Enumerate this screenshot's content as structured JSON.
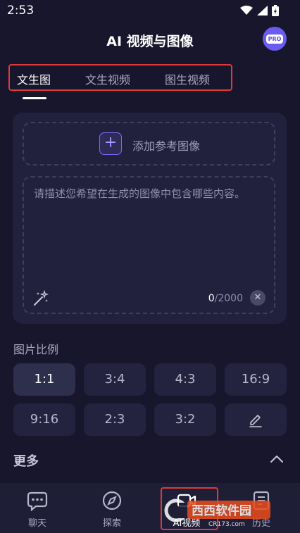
{
  "status": {
    "time": "2:53",
    "icons": [
      "wifi-icon",
      "signal-icon",
      "battery-icon"
    ]
  },
  "header": {
    "title": "AI 视频与图像",
    "pro_badge": "PRO"
  },
  "tabs": [
    {
      "label": "文生图",
      "active": true
    },
    {
      "label": "文生视频",
      "active": false
    },
    {
      "label": "图生视频",
      "active": false
    }
  ],
  "reference": {
    "label": "添加参考图像"
  },
  "prompt": {
    "placeholder": "请描述您希望在生成的图像中包含哪些内容。",
    "count_current": "0",
    "count_max": "/2000"
  },
  "ratio": {
    "label": "图片比例",
    "options": [
      "1:1",
      "3:4",
      "4:3",
      "16:9",
      "9:16",
      "2:3",
      "3:2"
    ],
    "selected": "1:1",
    "custom_icon": "edit-icon"
  },
  "more": {
    "label": "更多"
  },
  "bottom_nav": [
    {
      "label": "聊天",
      "icon": "chat-icon",
      "active": false
    },
    {
      "label": "探索",
      "icon": "compass-icon",
      "active": false
    },
    {
      "label": "AI视频",
      "icon": "video-icon",
      "active": true
    },
    {
      "label": "历史",
      "icon": "history-icon",
      "active": false
    }
  ],
  "watermark": {
    "text": "西西软件园",
    "url_text": "CR173.com"
  },
  "colors": {
    "background": "#17162c",
    "card": "#22213d",
    "accent": "#7b6cf6",
    "highlight_border": "#e0393a"
  }
}
